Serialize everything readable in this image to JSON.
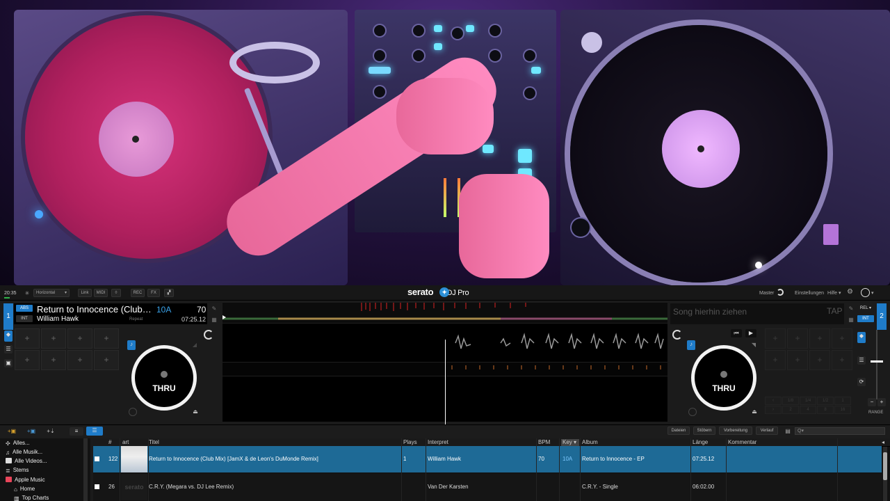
{
  "colors": {
    "accent": "#1f7cc9",
    "key_blue": "#3ba3ea",
    "selected_row": "#1e6a96",
    "background": "#1b1b1b"
  },
  "topbar": {
    "clock": "20:35",
    "layout": "Horizontal",
    "btn_link": "Link",
    "btn_midi": "MIDI",
    "btn_rec": "REC",
    "btn_fx": "FX",
    "logo_brand": "serato",
    "logo_product": "DJ Pro",
    "master": "Master",
    "settings": "Einstellungen",
    "help": "Hilfe",
    "icons": [
      "gear-icon",
      "user-icon",
      "star-icon"
    ]
  },
  "deck1": {
    "number": "1",
    "mode_abs": "ABS",
    "mode_int": "INT",
    "title": "Return to Innocence (Club Mix) [JamX & de Leon's DuMonde Remix]",
    "artist": "William Hawk",
    "key": "10A",
    "bpm": "70",
    "remaining_time": "07:25.12",
    "repeat": "Repeat",
    "vinyl_label": "THRU",
    "cue_symbol": "+"
  },
  "deck2": {
    "number": "2",
    "mode_rel": "REL",
    "mode_int": "INT",
    "drop_placeholder": "Song hierhin ziehen",
    "tap": "TAP",
    "vinyl_label": "THRU",
    "cue_symbol": "+",
    "loop_values": [
      "1/8",
      "1/4",
      "1/2",
      "1",
      "2",
      "4",
      "8",
      "16"
    ],
    "range": "RANGE"
  },
  "library_tabs": {
    "files": "Dateien",
    "browse": "Stöbern",
    "prepare": "Vorbereitung",
    "history": "Verlauf",
    "search_placeholder": "Q▾"
  },
  "sidebar": {
    "items": [
      {
        "label": "Alles...",
        "icon": "all-crates-icon"
      },
      {
        "label": "Alle Musik...",
        "icon": "music-note-icon"
      },
      {
        "label": "Alle Videos...",
        "icon": "video-icon"
      },
      {
        "label": "Stems",
        "icon": "stems-icon"
      },
      {
        "label": "Apple Music",
        "icon": "apple-music-icon"
      },
      {
        "label": "Home",
        "icon": "home-icon"
      },
      {
        "label": "Top Charts",
        "icon": "chart-icon"
      }
    ]
  },
  "tracklist": {
    "headers": {
      "num": "#",
      "art": "art",
      "title": "Titel",
      "plays": "Plays",
      "artist": "Interpret",
      "bpm": "BPM",
      "key": "Key",
      "album": "Album",
      "length": "Länge",
      "comment": "Kommentar"
    },
    "rows": [
      {
        "num": "122",
        "title": "Return to Innocence (Club Mix) [JamX & de Leon's DuMonde Remix]",
        "plays": "1",
        "artist": "William Hawk",
        "bpm": "70",
        "key": "10A",
        "album": "Return to Innocence - EP",
        "length": "07:25.12",
        "comment": "",
        "art_text": ""
      },
      {
        "num": "26",
        "title": "C.R.Y. (Megara vs. DJ Lee Remix)",
        "plays": "",
        "artist": "Van Der Karsten",
        "bpm": "",
        "key": "",
        "album": "C.R.Y. - Single",
        "length": "06:02.00",
        "comment": "",
        "art_text": "serato"
      }
    ]
  }
}
